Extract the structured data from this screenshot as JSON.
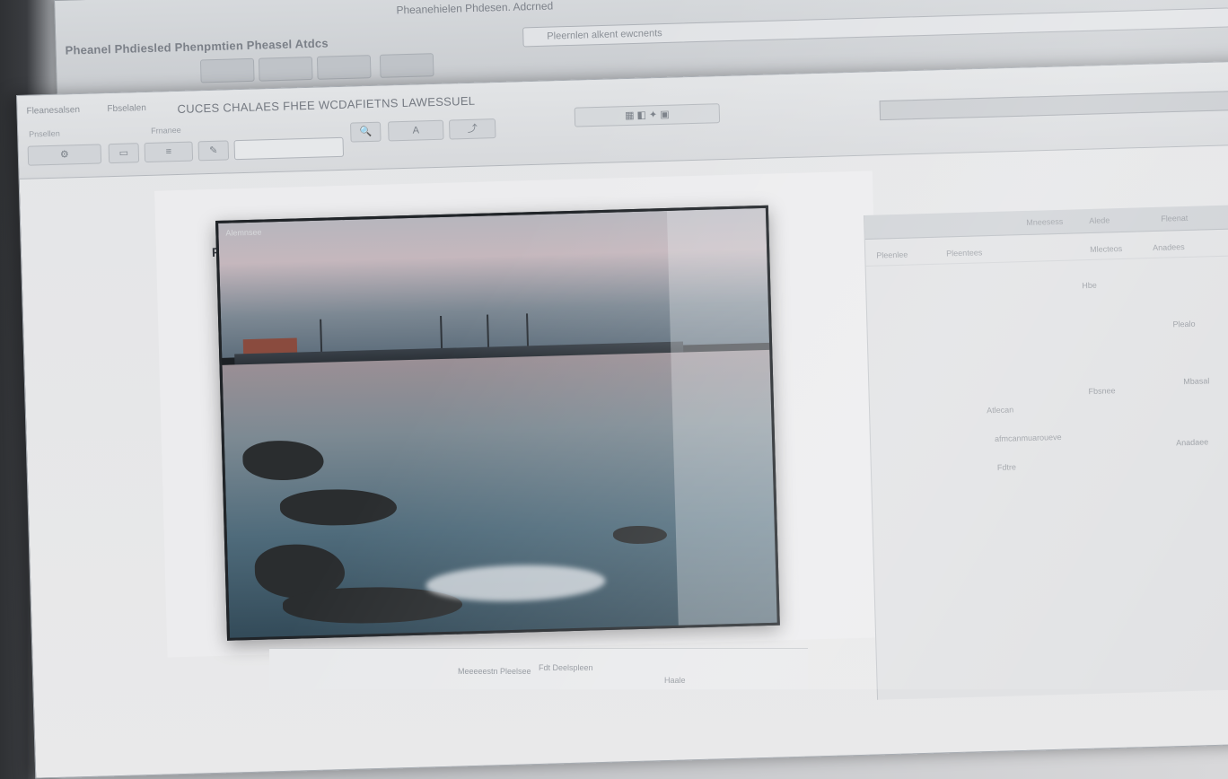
{
  "back_window": {
    "title": "Pheanel Phdiesled Phenpmtien Pheasel Atdcs",
    "doc_title": "Pheanehielen Phdesen. Adcrned",
    "address": "Pleernlen alkent ewcnents"
  },
  "ribbon": {
    "app_title": "CUCES CHALAES FHEE WCDAFIETNS LAWESSUEL",
    "tabs": [
      "Fleanesalsen",
      "Fbselalen"
    ],
    "group_labels": [
      "Pnsellen",
      "Frnanee"
    ]
  },
  "canvas": {
    "label": "FRK",
    "photo_caption": "Alemnsee"
  },
  "right_panel": {
    "header_items": [
      "Mneesess",
      "Alede",
      "Fleenat"
    ],
    "col_headers": [
      "Pleenlee",
      "Pleentees",
      "Mlecteos",
      "Anadees"
    ],
    "items": [
      "Hbe",
      "Plealo",
      "Fbsnee",
      "Mbasal",
      "Atlecan",
      "afmcanmuaroueve",
      "Anadaee",
      "Fdtre"
    ]
  },
  "bottom_bar": {
    "left_label": "Meeeeestn Pleelsee",
    "mid_label": "Fdt Deelspleen",
    "right_label": "Haale"
  }
}
